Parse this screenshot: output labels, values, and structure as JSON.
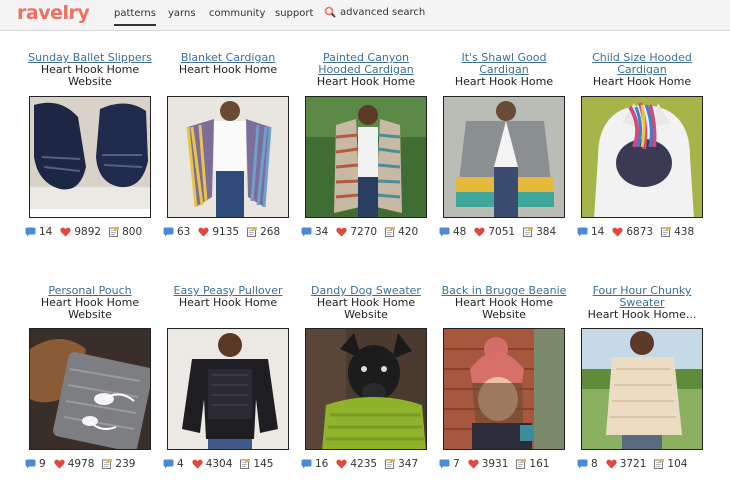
{
  "header": {
    "logo": "ravelry",
    "nav": [
      "patterns",
      "yarns",
      "community",
      "support"
    ],
    "search_label": "advanced search"
  },
  "cards": [
    {
      "title": "Sunday Ballet Slippers",
      "author1": "Heart Hook Home",
      "author2": "Website",
      "comments": "14",
      "hearts": "9892",
      "projects": "800",
      "img": "slippers"
    },
    {
      "title": "Blanket Cardigan",
      "author1": "Heart Hook Home",
      "author2": "",
      "comments": "63",
      "hearts": "9135",
      "projects": "268",
      "img": "cardigan-stripes"
    },
    {
      "title": "Painted Canyon Hooded Cardigan",
      "author1": "Heart Hook Home",
      "author2": "",
      "comments": "34",
      "hearts": "7270",
      "projects": "420",
      "img": "hooded-cardigan"
    },
    {
      "title": "It's Shawl Good Cardigan",
      "author1": "Heart Hook Home",
      "author2": "",
      "comments": "48",
      "hearts": "7051",
      "projects": "384",
      "img": "shawl-cardigan"
    },
    {
      "title": "Child Size Hooded Cardigan",
      "author1": "Heart Hook Home",
      "author2": "",
      "comments": "14",
      "hearts": "6873",
      "projects": "438",
      "img": "child-hood"
    },
    {
      "title": "Personal Pouch",
      "author1": "Heart Hook Home",
      "author2": "Website",
      "comments": "9",
      "hearts": "4978",
      "projects": "239",
      "img": "pouch"
    },
    {
      "title": "Easy Peasy Pullover",
      "author1": "Heart Hook Home",
      "author2": "",
      "comments": "4",
      "hearts": "4304",
      "projects": "145",
      "img": "pullover"
    },
    {
      "title": "Dandy Dog Sweater",
      "author1": "Heart Hook Home",
      "author2": "Website",
      "comments": "16",
      "hearts": "4235",
      "projects": "347",
      "img": "dog"
    },
    {
      "title": "Back in Brugge Beanie",
      "author1": "Heart Hook Home",
      "author2": "Website",
      "comments": "7",
      "hearts": "3931",
      "projects": "161",
      "img": "beanie"
    },
    {
      "title": "Four Hour Chunky Sweater",
      "author1": "Heart Hook Home...",
      "author2": "",
      "comments": "8",
      "hearts": "3721",
      "projects": "104",
      "img": "chunky"
    }
  ],
  "colors": {
    "brand": "#ee6e62",
    "link": "#3f6f90",
    "comment": "#4a8ad8",
    "heart": "#e2463c"
  }
}
